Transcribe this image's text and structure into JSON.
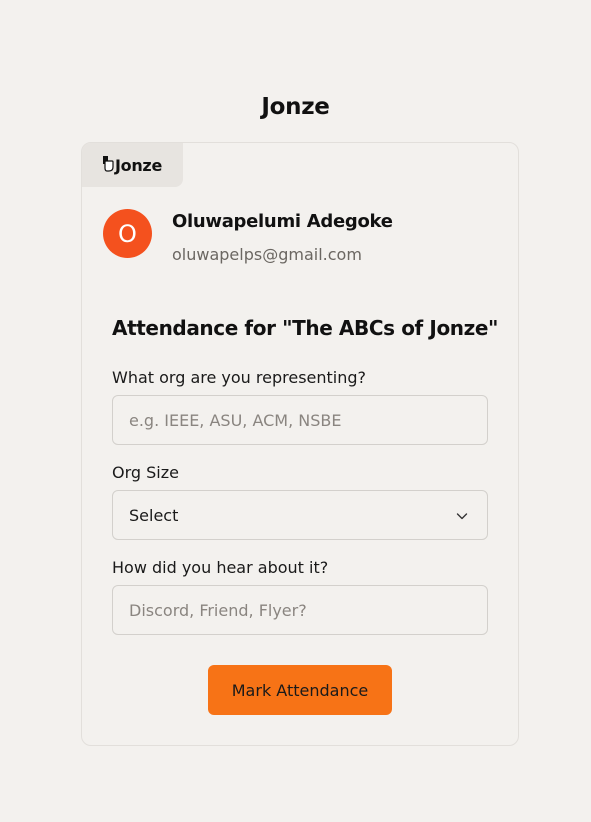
{
  "page": {
    "title": "Jonze"
  },
  "brand": {
    "name": "Jonze",
    "icon": "jonze-logo-icon"
  },
  "user": {
    "avatar_initial": "O",
    "avatar_color": "#f4511e",
    "name": "Oluwapelumi Adegoke",
    "email": "oluwapelps@gmail.com"
  },
  "form": {
    "heading": "Attendance for \"The ABCs of Jonze\"",
    "org_label": "What org are you representing?",
    "org_placeholder": "e.g. IEEE, ASU, ACM, NSBE",
    "size_label": "Org Size",
    "size_value": "Select",
    "heard_label": "How did you hear about it?",
    "heard_placeholder": "Discord, Friend, Flyer?",
    "submit_label": "Mark Attendance"
  },
  "colors": {
    "accent": "#f77316",
    "background": "#f3f1ee"
  }
}
